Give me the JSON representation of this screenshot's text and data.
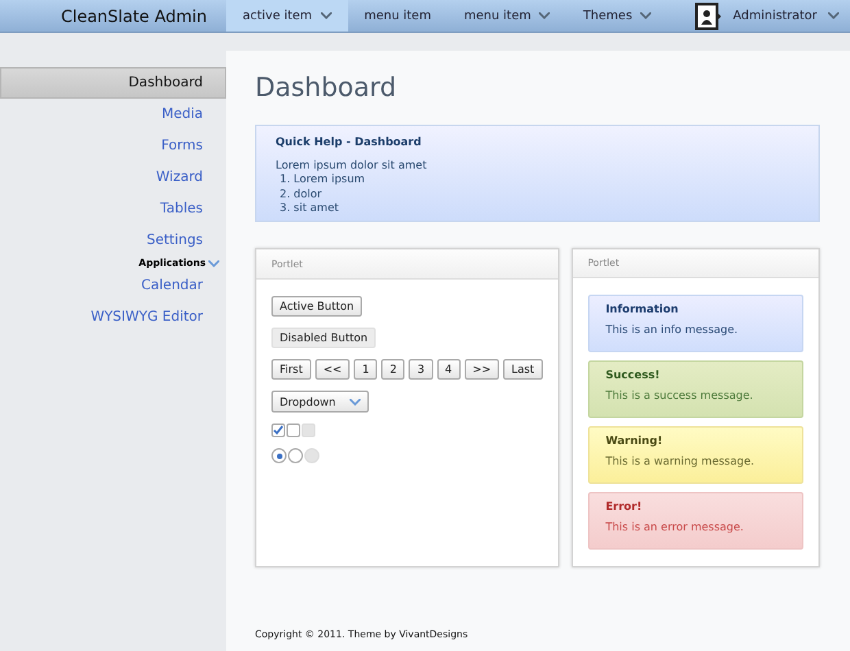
{
  "brand": "CleanSlate Admin",
  "nav": [
    {
      "label": "active item",
      "selected": true,
      "caret": true
    },
    {
      "label": "menu item",
      "selected": false,
      "caret": false
    },
    {
      "label": "menu item",
      "selected": false,
      "caret": true
    },
    {
      "label": "Themes",
      "selected": false,
      "caret": true
    }
  ],
  "user": {
    "name": "Administrator"
  },
  "sidebar": [
    {
      "kind": "link",
      "label": "Dashboard",
      "selected": true
    },
    {
      "kind": "link",
      "label": "Media",
      "selected": false
    },
    {
      "kind": "link",
      "label": "Forms",
      "selected": false
    },
    {
      "kind": "link",
      "label": "Wizard",
      "selected": false
    },
    {
      "kind": "link",
      "label": "Tables",
      "selected": false
    },
    {
      "kind": "link",
      "label": "Settings",
      "selected": false
    },
    {
      "kind": "heading",
      "label": "Applications"
    },
    {
      "kind": "link",
      "label": "Calendar",
      "selected": false
    },
    {
      "kind": "link",
      "label": "WYSIWYG Editor",
      "selected": false
    }
  ],
  "title": "Dashboard",
  "help": {
    "title": "Quick Help - Dashboard",
    "text": "Lorem ipsum dolor sit amet",
    "items": [
      "1. Lorem ipsum",
      "2. dolor",
      "3. sit amet"
    ]
  },
  "left_portlet": {
    "title": "Portlet",
    "buttons": [
      {
        "label": "Active Button",
        "disabled": false
      },
      {
        "label": "Disabled Button",
        "disabled": true
      }
    ],
    "pager": [
      "First",
      "<<",
      "1",
      "2",
      "3",
      "4",
      ">>",
      "Last"
    ],
    "dropdown": "Dropdown",
    "checkboxes": [
      {
        "checked": true,
        "disabled": false
      },
      {
        "checked": false,
        "disabled": false
      },
      {
        "checked": false,
        "disabled": true
      }
    ],
    "radios": [
      {
        "selected": true,
        "disabled": false
      },
      {
        "selected": false,
        "disabled": false
      },
      {
        "selected": false,
        "disabled": true
      }
    ]
  },
  "right_portlet": {
    "title": "Portlet",
    "messages": [
      {
        "kind": "info",
        "title": "Information",
        "text": "This is an info message."
      },
      {
        "kind": "success",
        "title": "Success!",
        "text": "This is a success message."
      },
      {
        "kind": "warning",
        "title": "Warning!",
        "text": "This is a warning message."
      },
      {
        "kind": "error",
        "title": "Error!",
        "text": "This is an error message."
      }
    ]
  },
  "footer": "Copyright © 2011. Theme by VivantDesigns"
}
